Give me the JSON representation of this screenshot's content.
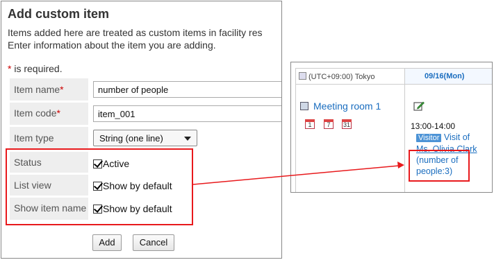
{
  "dialog": {
    "title": "Add custom item",
    "description_line1": "Items added here are treated as custom items in facility res",
    "description_line2": "Enter information about the item you are adding.",
    "required_star": "*",
    "required_note": " is required.",
    "fields": {
      "item_name_label": "Item name",
      "item_name_value": "number of people",
      "item_code_label": "Item code",
      "item_code_value": "item_001",
      "item_type_label": "Item type",
      "item_type_value": "String (one line)"
    },
    "options": {
      "status_label": "Status",
      "status_value": "Active",
      "list_view_label": "List view",
      "list_view_value": "Show by default",
      "show_item_name_label": "Show item name",
      "show_item_name_value": "Show by default"
    },
    "add_button": "Add",
    "cancel_button": "Cancel"
  },
  "calendar": {
    "timezone": "(UTC+09:00) Tokyo",
    "date_header": "09/16(Mon)",
    "room_name": "Meeting room 1",
    "mini_icons": [
      "1",
      "7",
      "31"
    ],
    "event": {
      "time": "13:00-14:00",
      "badge": "Visitor",
      "title_part1": "Visit of",
      "title_part2": "Ms. Olivia Clark",
      "detail_line1": "(number of",
      "detail_line2": "people:3)"
    }
  },
  "colors": {
    "highlight_red": "#e8191c",
    "link_blue": "#1a6dbf",
    "label_bg": "#eeeeee"
  }
}
